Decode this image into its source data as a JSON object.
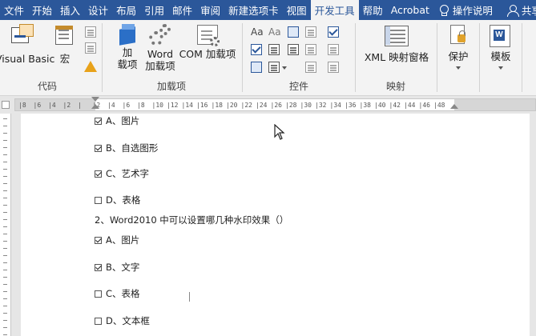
{
  "tabs": [
    {
      "label": "文件",
      "active": false
    },
    {
      "label": "开始",
      "active": false
    },
    {
      "label": "插入",
      "active": false
    },
    {
      "label": "设计",
      "active": false
    },
    {
      "label": "布局",
      "active": false
    },
    {
      "label": "引用",
      "active": false
    },
    {
      "label": "邮件",
      "active": false
    },
    {
      "label": "审阅",
      "active": false
    },
    {
      "label": "新建选项卡",
      "active": false
    },
    {
      "label": "视图",
      "active": false
    },
    {
      "label": "开发工具",
      "active": true
    },
    {
      "label": "帮助",
      "active": false
    },
    {
      "label": "Acrobat",
      "active": false
    }
  ],
  "tell_me": "操作说明",
  "share": "共享",
  "ribbon": {
    "code": {
      "label": "代码",
      "visual_basic": "Visual Basic",
      "macros": "宏"
    },
    "addins": {
      "label": "加载项",
      "addins_btn_l1": "加",
      "addins_btn_l2": "载项",
      "word_addins_l1": "Word",
      "word_addins_l2": "加载项",
      "com_addins": "COM 加载项"
    },
    "controls": {
      "label": "控件"
    },
    "mapping": {
      "label": "映射",
      "xml_pane": "XML 映射窗格"
    },
    "protect": {
      "label": "保护"
    },
    "templates": {
      "label": "模板"
    }
  },
  "ruler_ticks": [
    "8",
    "6",
    "4",
    "2",
    "",
    "2",
    "4",
    "6",
    "8",
    "10",
    "12",
    "14",
    "16",
    "18",
    "20",
    "22",
    "24",
    "26",
    "28",
    "30",
    "32",
    "34",
    "36",
    "38",
    "40",
    "42",
    "44",
    "46",
    "48"
  ],
  "document": {
    "lines": [
      {
        "type": "option",
        "checked": true,
        "text": "A、图片"
      },
      {
        "type": "option",
        "checked": true,
        "text": "B、自选图形"
      },
      {
        "type": "option",
        "checked": true,
        "text": "C、艺术字"
      },
      {
        "type": "option",
        "checked": false,
        "text": "D、表格"
      },
      {
        "type": "question",
        "text": "2、Word2010 中可以设置哪几种水印效果（）"
      },
      {
        "type": "option",
        "checked": true,
        "text": "A、图片"
      },
      {
        "type": "option",
        "checked": true,
        "text": "B、文字"
      },
      {
        "type": "option",
        "checked": false,
        "text": "C、表格"
      },
      {
        "type": "option",
        "checked": false,
        "text": "D、文本框"
      }
    ]
  },
  "colors": {
    "accent": "#2b579a",
    "ribbon_bg": "#f3f3f3",
    "canvas_bg": "#e6e6e6"
  }
}
